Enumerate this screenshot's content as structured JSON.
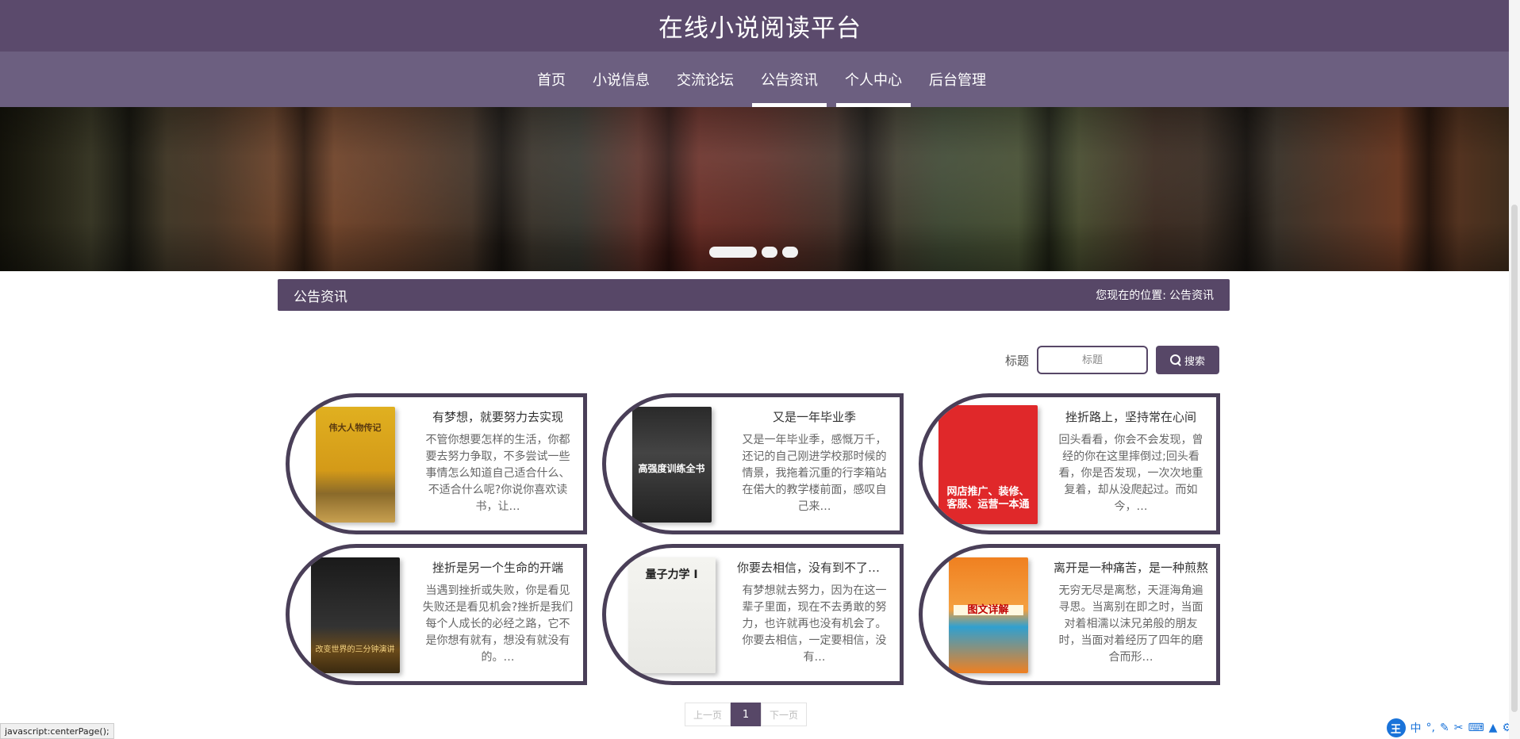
{
  "header": {
    "title": "在线小说阅读平台"
  },
  "nav": {
    "items": [
      {
        "label": "首页"
      },
      {
        "label": "小说信息"
      },
      {
        "label": "交流论坛"
      },
      {
        "label": "公告资讯"
      },
      {
        "label": "个人中心"
      },
      {
        "label": "后台管理"
      }
    ]
  },
  "section": {
    "title": "公告资讯",
    "breadcrumb_prefix": "您现在的位置:",
    "breadcrumb_current": "公告资讯"
  },
  "search": {
    "label": "标题",
    "placeholder": "标题",
    "button_label": "搜索"
  },
  "cards": [
    {
      "title": "有梦想，就要努力去实现",
      "desc": "不管你想要怎样的生活，你都要去努力争取，不多尝试一些事情怎么知道自己适合什么、不适合什么呢?你说你喜欢读书，让…",
      "cover_text": "伟大人物传记"
    },
    {
      "title": "又是一年毕业季",
      "desc": "又是一年毕业季，感慨万千，还记的自己刚进学校那时候的情景，我拖着沉重的行李箱站在偌大的教学楼前面，感叹自己来…",
      "cover_text": "高强度训练全书"
    },
    {
      "title": "挫折路上，坚持常在心间",
      "desc": "回头看看，你会不会发现，曾经的你在这里摔倒过;回头看看，你是否发现，一次次地重复着，却从没爬起过。而如今，…",
      "cover_text": "网店推广、装修、客服、运营一本通"
    },
    {
      "title": "挫折是另一个生命的开端",
      "desc": "当遇到挫折或失败，你是看见失败还是看见机会?挫折是我们每个人成长的必经之路，它不是你想有就有，想没有就没有的。…",
      "cover_text": "改变世界的三分钟演讲"
    },
    {
      "title": "你要去相信，没有到不了的明天",
      "desc": "有梦想就去努力，因为在这一辈子里面，现在不去勇敢的努力，也许就再也没有机会了。你要去相信，一定要相信，没有…",
      "cover_text": "量子力学 I"
    },
    {
      "title": "离开是一种痛苦，是一种煎熬",
      "desc": "无穷无尽是离愁，天涯海角遍寻思。当离别在即之时，当面对着相濡以沫兄弟般的朋友时，当面对着经历了四年的磨合而形…",
      "cover_text": "图文详解"
    }
  ],
  "pagination": {
    "prev": "上一页",
    "current": "1",
    "next": "下一页"
  },
  "status_bar": {
    "text": "javascript:centerPage();"
  },
  "ime": {
    "logo": "王",
    "mode": "中"
  }
}
